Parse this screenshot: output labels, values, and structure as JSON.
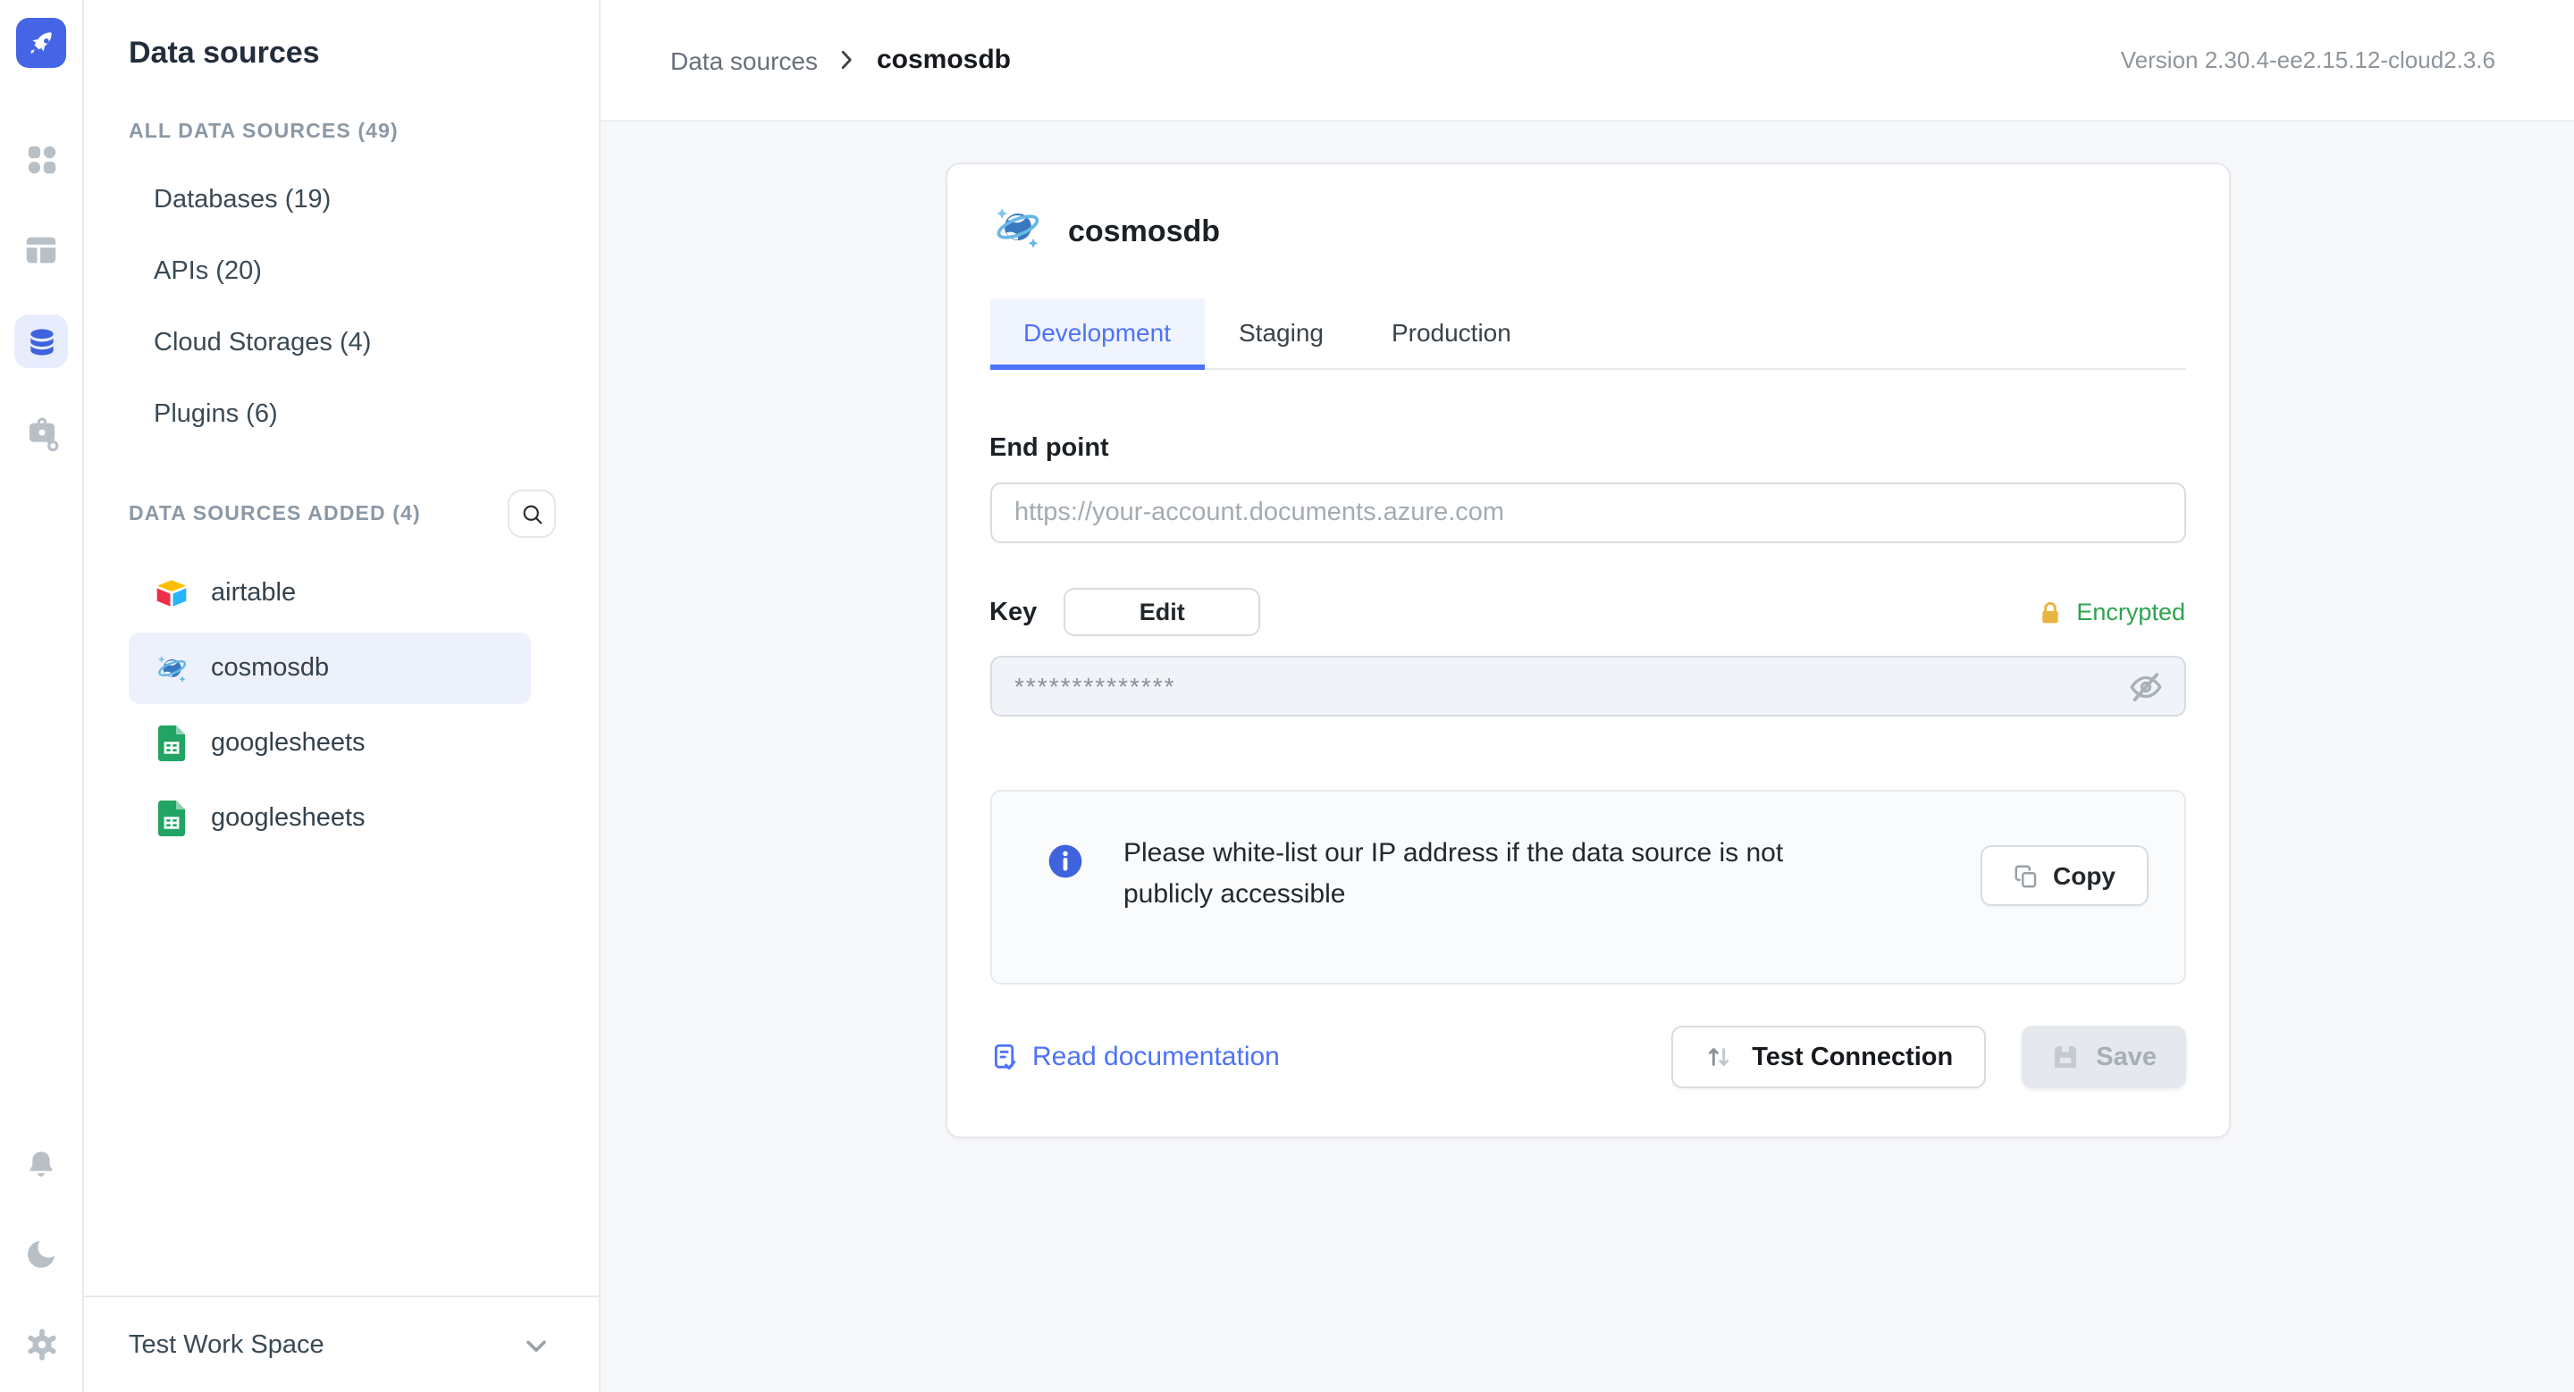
{
  "sidebar": {
    "title": "Data sources",
    "sections": [
      {
        "label": "ALL DATA SOURCES (49)",
        "items": [
          {
            "label": "Databases (19)"
          },
          {
            "label": "APIs (20)"
          },
          {
            "label": "Cloud Storages (4)"
          },
          {
            "label": "Plugins (6)"
          }
        ]
      },
      {
        "label": "DATA SOURCES ADDED (4)",
        "items": [
          {
            "label": "airtable",
            "icon": "airtable-icon",
            "selected": false
          },
          {
            "label": "cosmosdb",
            "icon": "cosmosdb-icon",
            "selected": true
          },
          {
            "label": "googlesheets",
            "icon": "googlesheets-icon",
            "selected": false
          },
          {
            "label": "googlesheets",
            "icon": "googlesheets-icon",
            "selected": false
          }
        ]
      }
    ],
    "workspace": {
      "label": "Test Work Space"
    }
  },
  "header": {
    "breadcrumb_root": "Data sources",
    "breadcrumb_current": "cosmosdb",
    "version": "Version 2.30.4-ee2.15.12-cloud2.3.6"
  },
  "card": {
    "title": "cosmosdb",
    "tabs": [
      {
        "label": "Development",
        "active": true
      },
      {
        "label": "Staging",
        "active": false
      },
      {
        "label": "Production",
        "active": false
      }
    ],
    "form": {
      "endpoint_label": "End point",
      "endpoint_placeholder": "https://your-account.documents.azure.com",
      "key_label": "Key",
      "edit_button": "Edit",
      "encrypted_label": "Encrypted",
      "key_masked": "**************",
      "info_text": "Please white-list our IP address if the data source is not publicly accessible",
      "copy_button": "Copy",
      "docs_link": "Read documentation",
      "test_button": "Test Connection",
      "save_button": "Save"
    }
  },
  "colors": {
    "accent": "#4D72FA",
    "logo": "#4565E6",
    "encrypted_green": "#2DA44E",
    "lock_gold": "#E9B343",
    "selected_bg": "#EDF1FC",
    "content_bg": "#F7F8FA"
  }
}
